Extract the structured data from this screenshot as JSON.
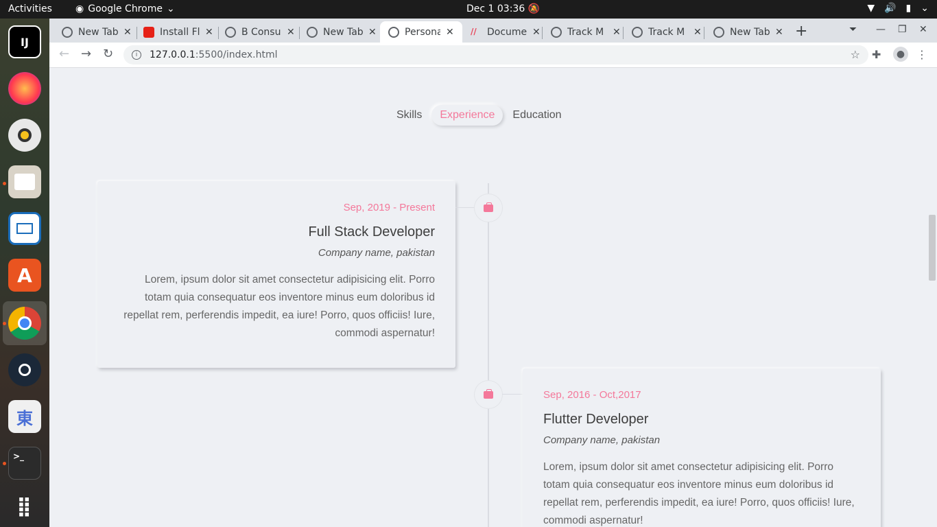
{
  "os": {
    "activities": "Activities",
    "app_name": "Google Chrome",
    "clock": "Dec 1  03:36"
  },
  "browser": {
    "tabs": [
      {
        "label": "New Tab"
      },
      {
        "label": "Install Fl"
      },
      {
        "label": "B Consu"
      },
      {
        "label": "New Tab"
      },
      {
        "label": "Persona"
      },
      {
        "label": "Docume"
      },
      {
        "label": "Track M"
      },
      {
        "label": "Track M"
      },
      {
        "label": "New Tab"
      }
    ],
    "url_host": "127.0.0.1",
    "url_rest": ":5500/index.html"
  },
  "page": {
    "tabs": [
      {
        "label": "Skills"
      },
      {
        "label": "Experience"
      },
      {
        "label": "Education"
      }
    ],
    "experience": [
      {
        "date": "Sep, 2019 - Present",
        "title": "Full Stack Developer",
        "company": "Company name, pakistan",
        "description": "Lorem, ipsum dolor sit amet consectetur adipisicing elit. Porro totam quia consequatur eos inventore minus eum doloribus id repellat rem, perferendis impedit, ea iure! Porro, quos officiis! Iure, commodi aspernatur!"
      },
      {
        "date": "Sep, 2016 - Oct,2017",
        "title": "Flutter Developer",
        "company": "Company name, pakistan",
        "description": "Lorem, ipsum dolor sit amet consectetur adipisicing elit. Porro totam quia consequatur eos inventore minus eum doloribus id repellat rem, perferendis impedit, ea iure! Porro, quos officiis! Iure, commodi aspernatur!"
      }
    ]
  },
  "colors": {
    "accent": "#f4789a",
    "page_bg": "#eef0f4"
  }
}
